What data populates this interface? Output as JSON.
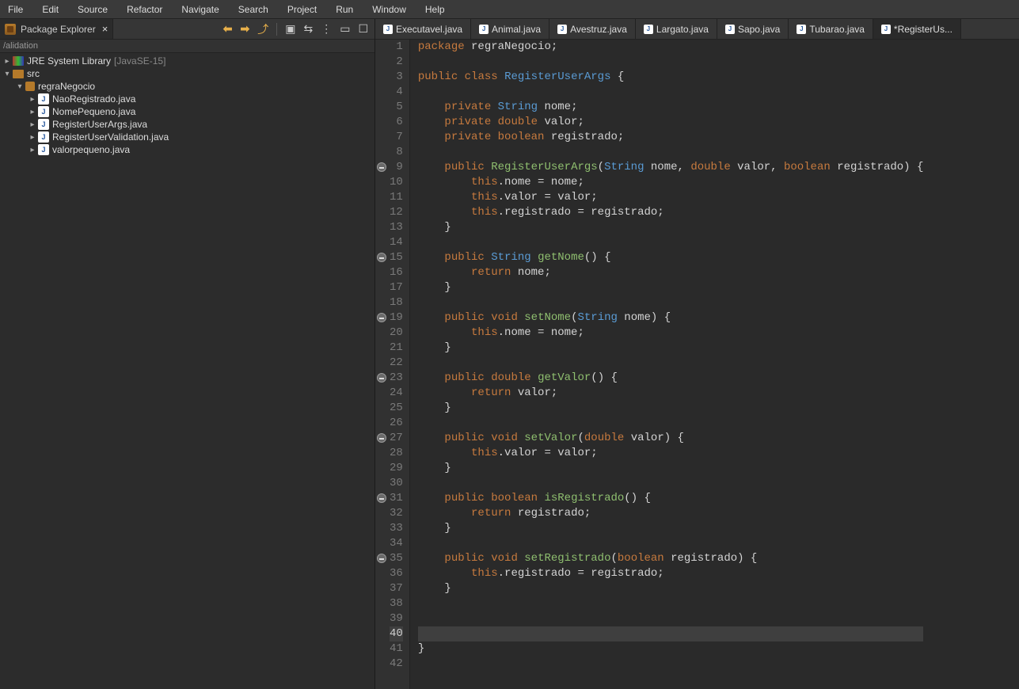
{
  "menubar": [
    "File",
    "Edit",
    "Source",
    "Refactor",
    "Navigate",
    "Search",
    "Project",
    "Run",
    "Window",
    "Help"
  ],
  "leftPane": {
    "viewTab": {
      "title": "Package Explorer"
    },
    "breadcrumb": "/alidation",
    "tree": {
      "jre": {
        "label": "JRE System Library",
        "extra": "[JavaSE-15]"
      },
      "src": {
        "label": "src"
      },
      "package": {
        "label": "regraNegocio"
      },
      "files": [
        "NaoRegistrado.java",
        "NomePequeno.java",
        "RegisterUserArgs.java",
        "RegisterUserValidation.java",
        "valorpequeno.java"
      ]
    }
  },
  "editorTabs": [
    {
      "label": "Executavel.java",
      "active": false,
      "dirty": false
    },
    {
      "label": "Animal.java",
      "active": false,
      "dirty": false
    },
    {
      "label": "Avestruz.java",
      "active": false,
      "dirty": false
    },
    {
      "label": "Largato.java",
      "active": false,
      "dirty": false
    },
    {
      "label": "Sapo.java",
      "active": false,
      "dirty": false
    },
    {
      "label": "Tubarao.java",
      "active": false,
      "dirty": false
    },
    {
      "label": "*RegisterUs...",
      "active": true,
      "dirty": true
    }
  ],
  "code": {
    "lineCount": 42,
    "currentLine": 40,
    "markers": {
      "9": "minus",
      "15": "minus",
      "19": "minus",
      "23": "minus",
      "27": "minus",
      "31": "minus",
      "35": "minus"
    },
    "tokens": {
      "package": "package",
      "regraNegocio": "regraNegocio",
      "public": "public",
      "class": "class",
      "RegisterUserArgs": "RegisterUserArgs",
      "private": "private",
      "String": "String",
      "nome": "nome",
      "double": "double",
      "valor": "valor",
      "boolean": "boolean",
      "registrado": "registrado",
      "this": "this",
      "return": "return",
      "void": "void",
      "getNome": "getNome",
      "setNome": "setNome",
      "getValor": "getValor",
      "setValor": "setValor",
      "isRegistrado": "isRegistrado",
      "setRegistrado": "setRegistrado"
    }
  }
}
